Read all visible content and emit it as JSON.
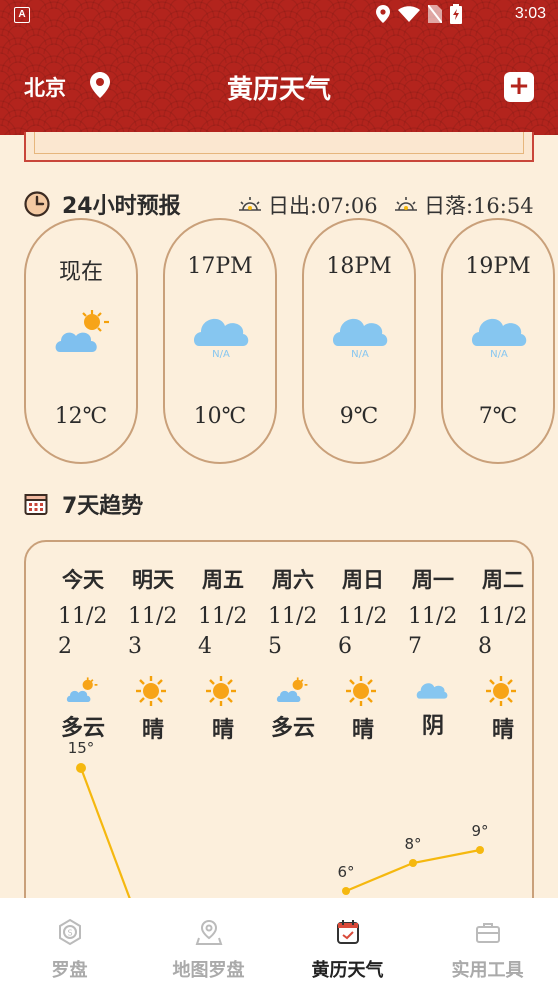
{
  "status_bar": {
    "time": "3:03",
    "app_icon": "A"
  },
  "header": {
    "city": "北京",
    "title": "黄历天气",
    "add_label": "+"
  },
  "hourly": {
    "section_title": "24小时预报",
    "sunrise": "日出:07:06",
    "sunset": "日落:16:54",
    "items": [
      {
        "label": "现在",
        "icon": "partly-cloudy-icon",
        "temp": "12℃"
      },
      {
        "label": "17PM",
        "icon": "cloud-na-icon",
        "temp": "10℃",
        "icon_text": "N/A"
      },
      {
        "label": "18PM",
        "icon": "cloud-na-icon",
        "temp": "9℃",
        "icon_text": "N/A"
      },
      {
        "label": "19PM",
        "icon": "cloud-na-icon",
        "temp": "7℃",
        "icon_text": "N/A"
      }
    ]
  },
  "trend": {
    "section_title": "7天趋势",
    "days": [
      {
        "name": "今天",
        "date": "11/22",
        "icon": "partly-cloudy-icon",
        "cond": "多云",
        "high": "15°"
      },
      {
        "name": "明天",
        "date": "11/23",
        "icon": "sun-icon",
        "cond": "晴",
        "high": ""
      },
      {
        "name": "周五",
        "date": "11/24",
        "icon": "sun-icon",
        "cond": "晴",
        "high": ""
      },
      {
        "name": "周六",
        "date": "11/25",
        "icon": "partly-cloudy-icon",
        "cond": "多云",
        "high": ""
      },
      {
        "name": "周日",
        "date": "11/26",
        "icon": "sun-icon",
        "cond": "晴",
        "high": "6°"
      },
      {
        "name": "周一",
        "date": "11/27",
        "icon": "cloud-icon",
        "cond": "阴",
        "high": "8°"
      },
      {
        "name": "周二",
        "date": "11/28",
        "icon": "sun-icon",
        "cond": "晴",
        "high": "9°"
      }
    ]
  },
  "tabs": [
    {
      "label": "罗盘",
      "icon": "compass-icon",
      "active": false
    },
    {
      "label": "地图罗盘",
      "icon": "map-pin-icon",
      "active": false
    },
    {
      "label": "黄历天气",
      "icon": "calendar-check-icon",
      "active": true
    },
    {
      "label": "实用工具",
      "icon": "toolbox-icon",
      "active": false
    }
  ],
  "colors": {
    "header_red": "#b3241d",
    "page_bg": "#fcefdc",
    "card_border": "#c9a07a",
    "line_yellow": "#f5b80f",
    "active_tab": "#222222",
    "inactive_tab": "#aaaaaa"
  }
}
